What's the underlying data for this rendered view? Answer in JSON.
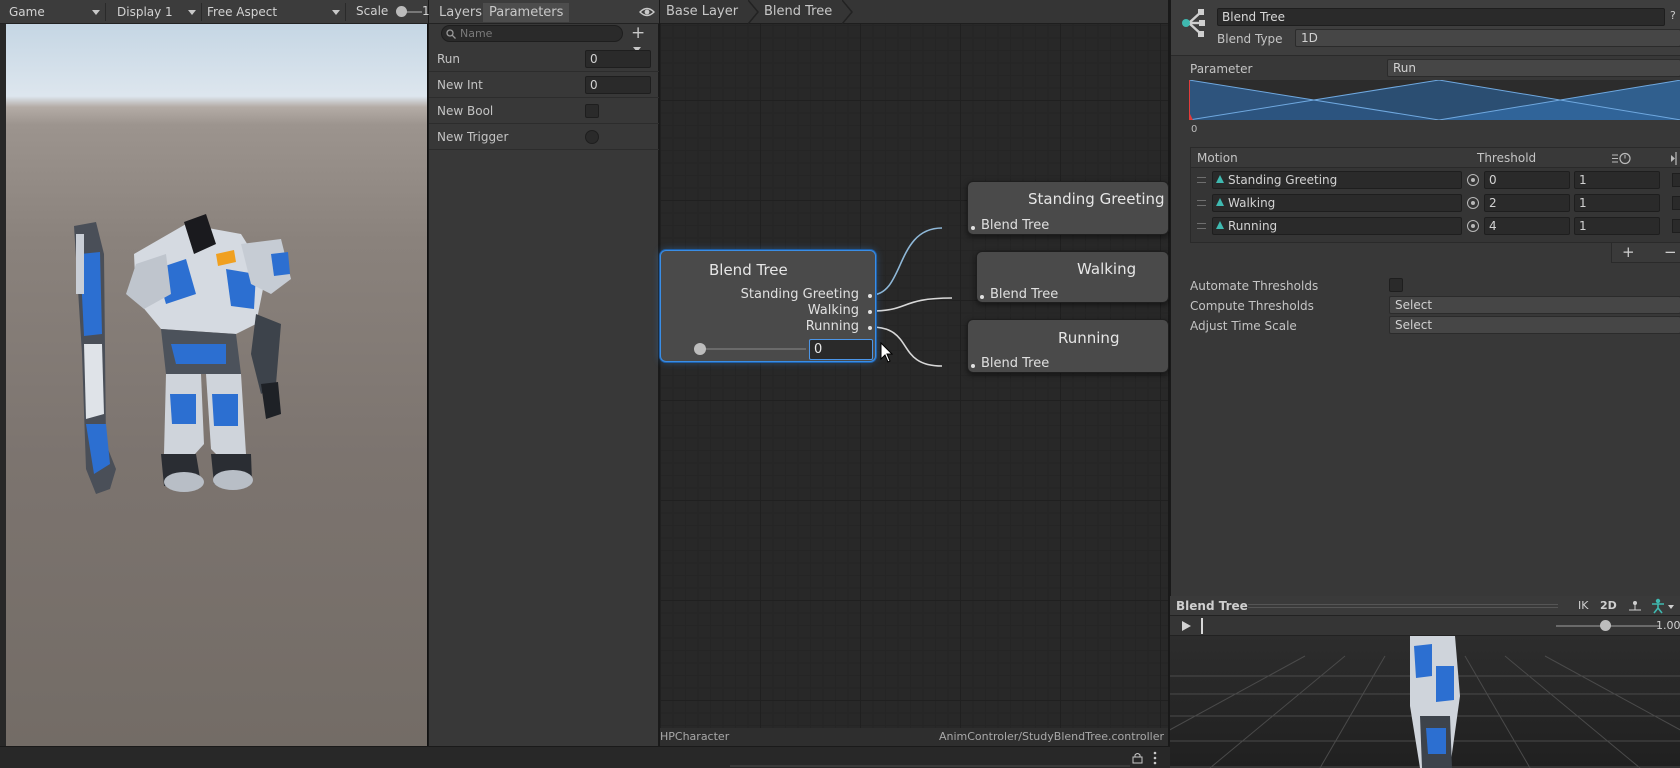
{
  "game": {
    "tab_label": "Game",
    "display": "Display 1",
    "aspect": "Free Aspect",
    "scale_label": "Scale",
    "scale_value": "1"
  },
  "params": {
    "tabs": [
      {
        "label": "Layers"
      },
      {
        "label": "Parameters"
      }
    ],
    "search_placeholder": "Name",
    "items": [
      {
        "label": "Run",
        "value": "0"
      },
      {
        "label": "New Int",
        "value": "0"
      },
      {
        "label": "New Bool"
      },
      {
        "label": "New Trigger"
      }
    ]
  },
  "graph": {
    "breadcrumbs": [
      "Base Layer",
      "Blend Tree"
    ],
    "main_node": {
      "title": "Blend Tree",
      "ports": [
        "Standing Greeting",
        "Walking",
        "Running"
      ],
      "value": "0",
      "slider_value": 0
    },
    "child_nodes": [
      {
        "title": "Standing Greeting",
        "subtitle": "Blend Tree"
      },
      {
        "title": "Walking",
        "subtitle": "Blend Tree"
      },
      {
        "title": "Running",
        "subtitle": "Blend Tree"
      }
    ],
    "footer_left": "HPCharacter",
    "footer_right": "AnimControler/StudyBlendTree.controller"
  },
  "inspector": {
    "name": "Blend Tree",
    "help_icon": "?",
    "blend_type_label": "Blend Type",
    "blend_type": "1D",
    "parameter_label": "Parameter",
    "parameter": "Run",
    "graph_min": "0",
    "table_headers": {
      "motion": "Motion",
      "threshold": "Threshold"
    },
    "motions": [
      {
        "name": "Standing Greeting",
        "threshold": "0",
        "speed": "1"
      },
      {
        "name": "Walking",
        "threshold": "2",
        "speed": "1"
      },
      {
        "name": "Running",
        "threshold": "4",
        "speed": "1"
      }
    ],
    "add_symbol": "+",
    "remove_symbol": "−",
    "automate_label": "Automate Thresholds",
    "compute_label": "Compute Thresholds",
    "compute_value": "Select",
    "adjust_label": "Adjust Time Scale",
    "adjust_value": "Select"
  },
  "preview": {
    "title": "Blend Tree",
    "ik": "IK",
    "mode_2d": "2D",
    "speed": "1.00"
  },
  "colors": {
    "accent": "#3a8ee6",
    "anim_icon": "#3fb9b0"
  }
}
